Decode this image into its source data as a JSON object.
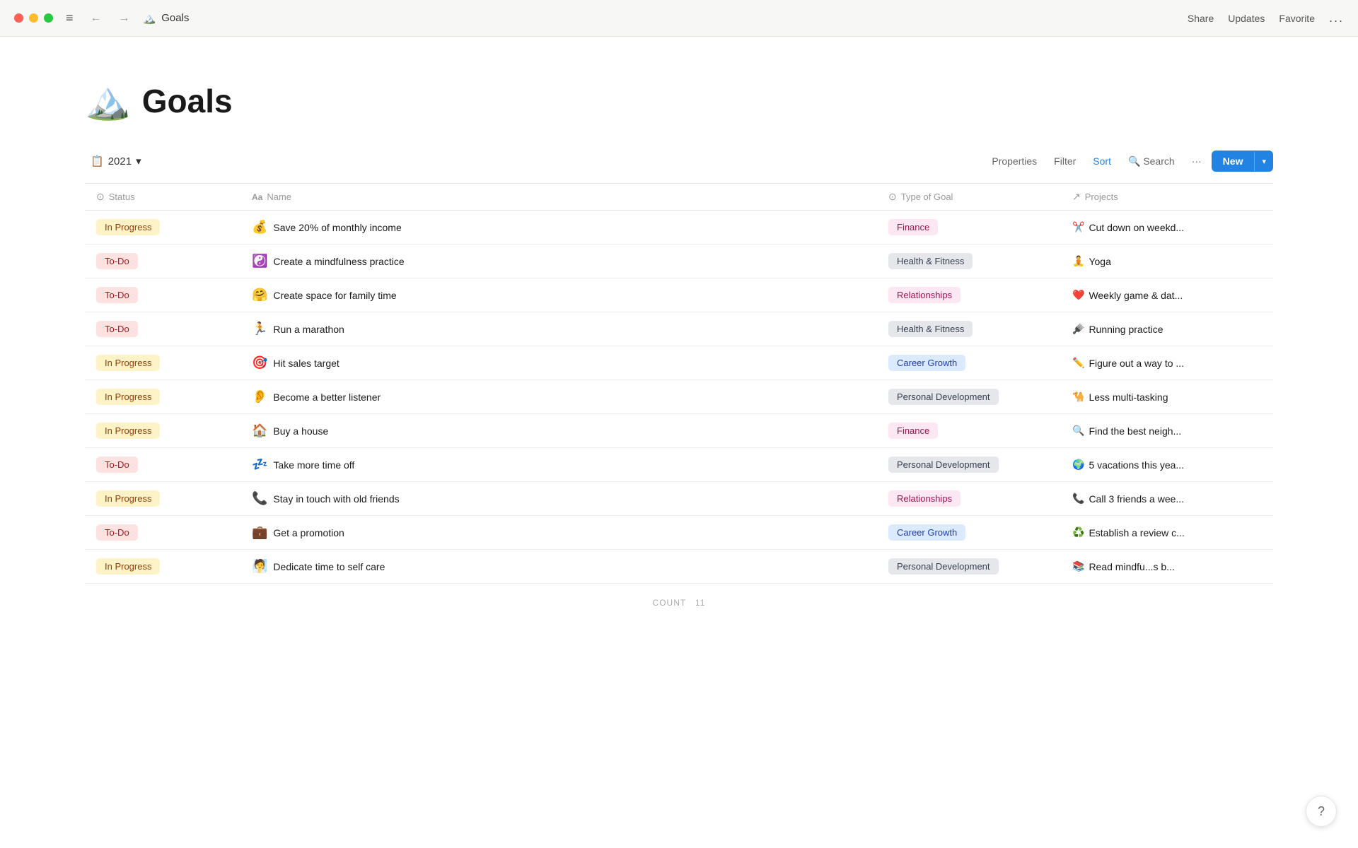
{
  "titlebar": {
    "page_name": "Goals",
    "page_icon": "🏔️",
    "nav_back": "←",
    "nav_forward": "→",
    "menu_icon": "≡",
    "share_label": "Share",
    "updates_label": "Updates",
    "favorite_label": "Favorite",
    "more_label": "..."
  },
  "toolbar": {
    "view_label": "2021",
    "view_icon": "📋",
    "properties_label": "Properties",
    "filter_label": "Filter",
    "sort_label": "Sort",
    "search_label": "Search",
    "more_label": "···",
    "new_label": "New",
    "dropdown_icon": "▾"
  },
  "table": {
    "columns": [
      {
        "key": "status",
        "label": "Status",
        "icon": "⊙"
      },
      {
        "key": "name",
        "label": "Name",
        "icon": "Aa"
      },
      {
        "key": "type",
        "label": "Type of Goal",
        "icon": "⊙"
      },
      {
        "key": "projects",
        "label": "Projects",
        "icon": "↗"
      }
    ],
    "rows": [
      {
        "status": "In Progress",
        "status_type": "in-progress",
        "name": "Save 20% of monthly income",
        "name_emoji": "💰",
        "type": "Finance",
        "type_class": "finance",
        "project_emoji": "✂️",
        "project": "Cut down on weekd..."
      },
      {
        "status": "To-Do",
        "status_type": "to-do",
        "name": "Create a mindfulness practice",
        "name_emoji": "☯️",
        "type": "Health & Fitness",
        "type_class": "health",
        "project_emoji": "🧘",
        "project": "Yoga"
      },
      {
        "status": "To-Do",
        "status_type": "to-do",
        "name": "Create space for family time",
        "name_emoji": "🤗",
        "type": "Relationships",
        "type_class": "relationships",
        "project_emoji": "❤️",
        "project": "Weekly game & dat..."
      },
      {
        "status": "To-Do",
        "status_type": "to-do",
        "name": "Run a marathon",
        "name_emoji": "🏃",
        "type": "Health & Fitness",
        "type_class": "health",
        "project_emoji": "🪮",
        "project": "Running practice"
      },
      {
        "status": "In Progress",
        "status_type": "in-progress",
        "name": "Hit sales target",
        "name_emoji": "🎯",
        "type": "Career Growth",
        "type_class": "career",
        "project_emoji": "✏️",
        "project": "Figure out a way to ..."
      },
      {
        "status": "In Progress",
        "status_type": "in-progress",
        "name": "Become a better listener",
        "name_emoji": "👂",
        "type": "Personal Development",
        "type_class": "personal",
        "project_emoji": "🐪",
        "project": "Less multi-tasking"
      },
      {
        "status": "In Progress",
        "status_type": "in-progress",
        "name": "Buy a house",
        "name_emoji": "🏠",
        "type": "Finance",
        "type_class": "finance",
        "project_emoji": "🔍",
        "project": "Find the best neigh..."
      },
      {
        "status": "To-Do",
        "status_type": "to-do",
        "name": "Take more time off",
        "name_emoji": "💤",
        "type": "Personal Development",
        "type_class": "personal",
        "project_emoji": "🌍",
        "project": "5 vacations this yea..."
      },
      {
        "status": "In Progress",
        "status_type": "in-progress",
        "name": "Stay in touch with old friends",
        "name_emoji": "📞",
        "type": "Relationships",
        "type_class": "relationships",
        "project_emoji": "📞",
        "project": "Call 3 friends a wee..."
      },
      {
        "status": "To-Do",
        "status_type": "to-do",
        "name": "Get a promotion",
        "name_emoji": "💼",
        "type": "Career Growth",
        "type_class": "career",
        "project_emoji": "♻️",
        "project": "Establish a review c..."
      },
      {
        "status": "In Progress",
        "status_type": "in-progress",
        "name": "Dedicate time to self care",
        "name_emoji": "🧖",
        "type": "Personal Development",
        "type_class": "personal",
        "project_emoji": "📚",
        "project": "Read mindfu...s b..."
      }
    ],
    "footer_count_label": "COUNT",
    "footer_count_value": "11"
  },
  "help_btn_label": "?"
}
